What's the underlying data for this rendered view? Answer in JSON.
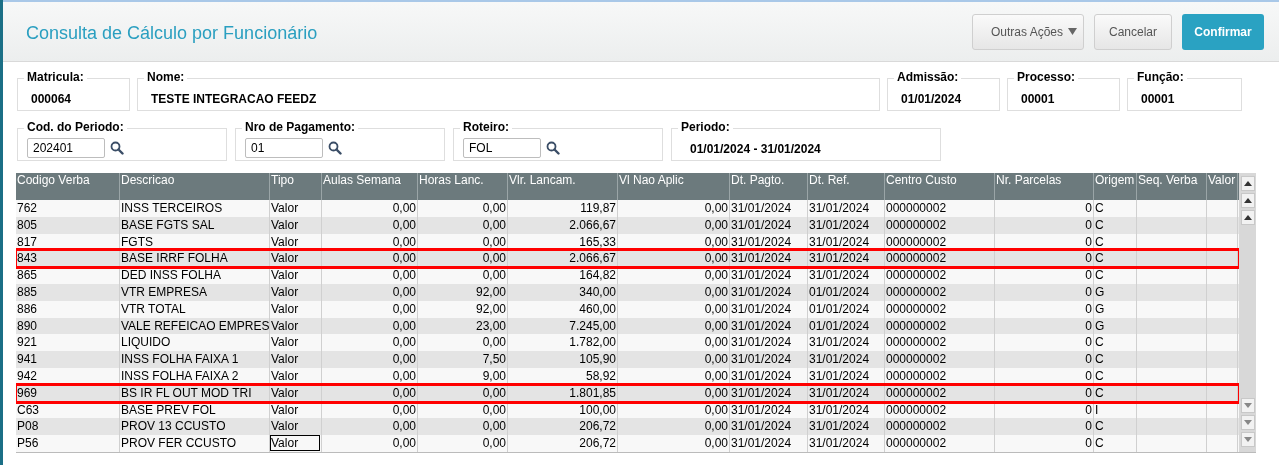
{
  "title": "Consulta de Cálculo por Funcionário",
  "actions": [
    {
      "label": "Outras Ações",
      "kind": "menu"
    },
    {
      "label": "Cancelar",
      "kind": "secondary"
    },
    {
      "label": "Confirmar",
      "kind": "primary"
    }
  ],
  "info_fields": [
    {
      "label": "Matricula:",
      "value": "000064"
    },
    {
      "label": "Nome:",
      "value": "TESTE INTEGRACAO FEEDZ"
    },
    {
      "label": "Admissão:",
      "value": "01/01/2024"
    },
    {
      "label": "Processo:",
      "value": "00001"
    },
    {
      "label": "Função:",
      "value": "00001"
    }
  ],
  "filter_fields": [
    {
      "label": "Cod. do Periodo:",
      "value": "202401",
      "kind": "lookup"
    },
    {
      "label": "Nro de Pagamento:",
      "value": "01",
      "kind": "lookup"
    },
    {
      "label": "Roteiro:",
      "value": "FOL",
      "kind": "lookup"
    },
    {
      "label": "Periodo:",
      "value": "01/01/2024 - 31/01/2024",
      "kind": "display"
    }
  ],
  "table": {
    "columns": [
      {
        "label": "Codigo Verba",
        "kind": "text"
      },
      {
        "label": "Descricao",
        "kind": "text"
      },
      {
        "label": "Tipo",
        "kind": "text"
      },
      {
        "label": "Aulas Semana",
        "kind": "number"
      },
      {
        "label": "Horas Lanc.",
        "kind": "number"
      },
      {
        "label": "Vlr. Lancam.",
        "kind": "number"
      },
      {
        "label": "Vl Nao Aplic",
        "kind": "number"
      },
      {
        "label": "Dt. Pagto.",
        "kind": "text"
      },
      {
        "label": "Dt. Ref.",
        "kind": "text"
      },
      {
        "label": "Centro Custo",
        "kind": "text"
      },
      {
        "label": "Nr. Parcelas",
        "kind": "number"
      },
      {
        "label": "Origem",
        "kind": "text"
      },
      {
        "label": "Seq. Verba",
        "kind": "text"
      },
      {
        "label": "Valor",
        "kind": "text"
      }
    ],
    "rows": [
      {
        "cells": [
          "762",
          "INSS TERCEIROS",
          "Valor",
          "0,00",
          "0,00",
          "119,87",
          "0,00",
          "31/01/2024",
          "31/01/2024",
          "000000002",
          "0",
          "C"
        ],
        "highlighted": false,
        "focused": false
      },
      {
        "cells": [
          "805",
          "BASE FGTS SAL",
          "Valor",
          "0,00",
          "0,00",
          "2.066,67",
          "0,00",
          "31/01/2024",
          "31/01/2024",
          "000000002",
          "0",
          "C"
        ],
        "highlighted": false,
        "focused": false
      },
      {
        "cells": [
          "817",
          "FGTS",
          "Valor",
          "0,00",
          "0,00",
          "165,33",
          "0,00",
          "31/01/2024",
          "31/01/2024",
          "000000002",
          "0",
          "C"
        ],
        "highlighted": false,
        "focused": false
      },
      {
        "cells": [
          "843",
          "BASE IRRF FOLHA",
          "Valor",
          "0,00",
          "0,00",
          "2.066,67",
          "0,00",
          "31/01/2024",
          "31/01/2024",
          "000000002",
          "0",
          "C"
        ],
        "highlighted": true,
        "focused": false
      },
      {
        "cells": [
          "865",
          "DED INSS FOLHA",
          "Valor",
          "0,00",
          "0,00",
          "164,82",
          "0,00",
          "31/01/2024",
          "31/01/2024",
          "000000002",
          "0",
          "C"
        ],
        "highlighted": false,
        "focused": false
      },
      {
        "cells": [
          "885",
          "VTR EMPRESA",
          "Valor",
          "0,00",
          "92,00",
          "340,00",
          "0,00",
          "31/01/2024",
          "01/01/2024",
          "000000002",
          "0",
          "G"
        ],
        "highlighted": false,
        "focused": false
      },
      {
        "cells": [
          "886",
          "VTR TOTAL",
          "Valor",
          "0,00",
          "92,00",
          "460,00",
          "0,00",
          "31/01/2024",
          "01/01/2024",
          "000000002",
          "0",
          "G"
        ],
        "highlighted": false,
        "focused": false
      },
      {
        "cells": [
          "890",
          "VALE REFEICAO EMPRES",
          "Valor",
          "0,00",
          "23,00",
          "7.245,00",
          "0,00",
          "31/01/2024",
          "01/01/2024",
          "000000002",
          "0",
          "G"
        ],
        "highlighted": false,
        "focused": false
      },
      {
        "cells": [
          "921",
          "LIQUIDO",
          "Valor",
          "0,00",
          "0,00",
          "1.782,00",
          "0,00",
          "31/01/2024",
          "31/01/2024",
          "000000002",
          "0",
          "C"
        ],
        "highlighted": false,
        "focused": false
      },
      {
        "cells": [
          "941",
          "INSS FOLHA FAIXA 1",
          "Valor",
          "0,00",
          "7,50",
          "105,90",
          "0,00",
          "31/01/2024",
          "31/01/2024",
          "000000002",
          "0",
          "C"
        ],
        "highlighted": false,
        "focused": false
      },
      {
        "cells": [
          "942",
          "INSS FOLHA FAIXA 2",
          "Valor",
          "0,00",
          "9,00",
          "58,92",
          "0,00",
          "31/01/2024",
          "31/01/2024",
          "000000002",
          "0",
          "C"
        ],
        "highlighted": false,
        "focused": false
      },
      {
        "cells": [
          "969",
          "BS IR FL OUT MOD TRI",
          "Valor",
          "0,00",
          "0,00",
          "1.801,85",
          "0,00",
          "31/01/2024",
          "31/01/2024",
          "000000002",
          "0",
          "C"
        ],
        "highlighted": true,
        "focused": false
      },
      {
        "cells": [
          "C63",
          "BASE PREV FOL",
          "Valor",
          "0,00",
          "0,00",
          "100,00",
          "0,00",
          "31/01/2024",
          "31/01/2024",
          "000000002",
          "0",
          "I"
        ],
        "highlighted": false,
        "focused": false
      },
      {
        "cells": [
          "P08",
          "PROV 13 CCUSTO",
          "Valor",
          "0,00",
          "0,00",
          "206,72",
          "0,00",
          "31/01/2024",
          "31/01/2024",
          "000000002",
          "0",
          "C"
        ],
        "highlighted": false,
        "focused": false
      },
      {
        "cells": [
          "P56",
          "PROV FER CCUSTO",
          "Valor",
          "0,00",
          "0,00",
          "206,72",
          "0,00",
          "31/01/2024",
          "31/01/2024",
          "000000002",
          "0",
          "C"
        ],
        "highlighted": false,
        "focused": true
      }
    ]
  }
}
